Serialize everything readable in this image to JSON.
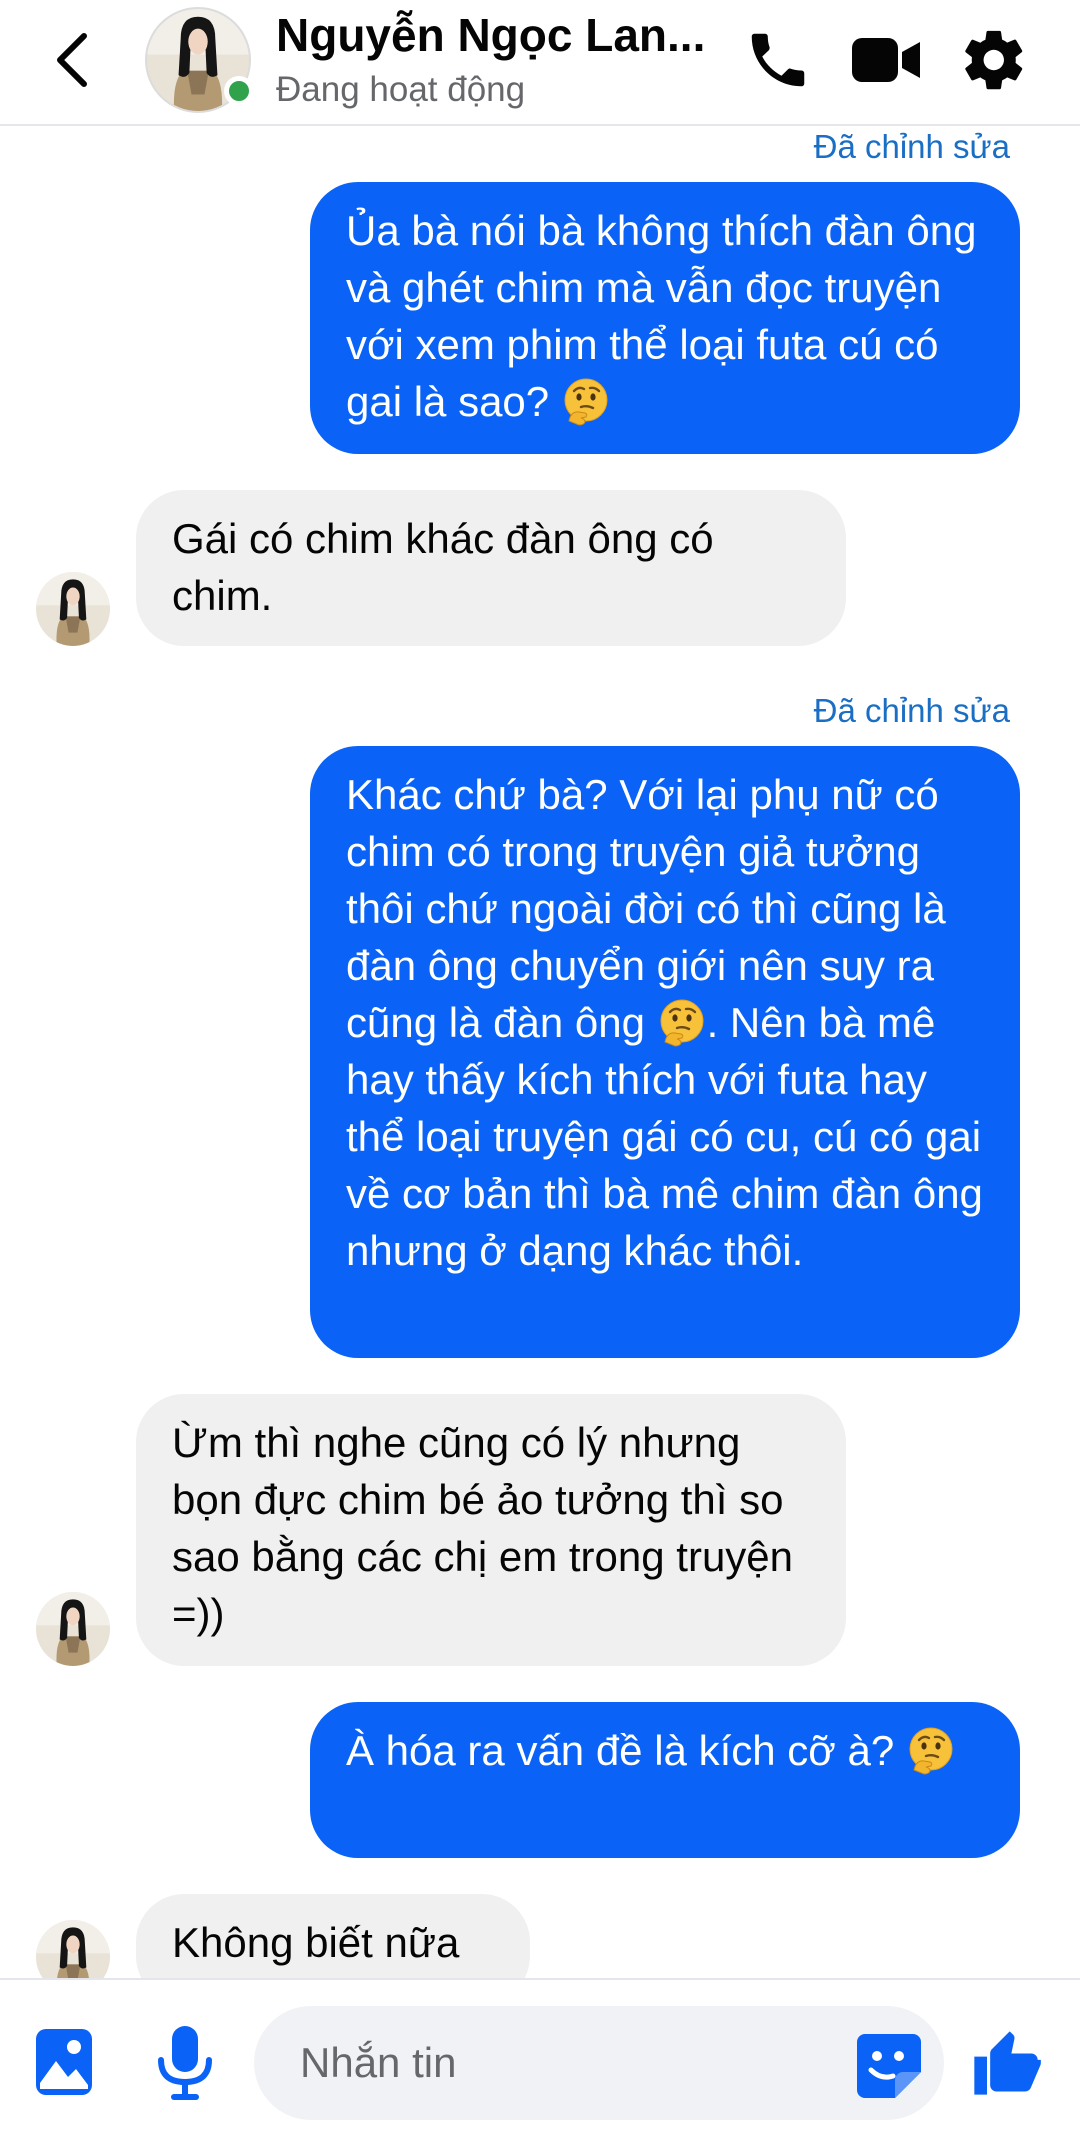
{
  "colors": {
    "accent": "#0a63f6",
    "incoming_bubble": "#f0f0f0",
    "online": "#31a24c",
    "edited_label": "#1a6fc4"
  },
  "header": {
    "back_icon": "chevron-left-icon",
    "contact_name": "Nguyễn Ngọc Lan...",
    "status": "Đang hoạt động",
    "actions": [
      "phone-icon",
      "video-camera-icon",
      "gear-icon"
    ]
  },
  "messages": [
    {
      "sender": "me",
      "edited_label": "Đã chỉnh sửa",
      "text": "Ủa bà nói bà không thích đàn ông và ghét chim mà vẫn đọc truyện với xem phim thể loại futa cú có gai là sao? ",
      "emoji": "thinking-face"
    },
    {
      "sender": "contact",
      "text": "Gái có chim khác đàn ông có chim."
    },
    {
      "sender": "me",
      "edited_label": "Đã chỉnh sửa",
      "text_before": "Khác chứ bà? Với lại phụ nữ có chim có trong truyện giả tưởng thôi chứ ngoài đời có thì cũng là đàn ông chuyển giới nên suy ra cũng là đàn ông ",
      "emoji": "thinking-face",
      "text_after": ". Nên bà mê hay thấy kích thích với futa hay thể loại truyện gái có cu, cú có gai về cơ bản thì bà mê chim đàn ông nhưng ở dạng khác thôi."
    },
    {
      "sender": "contact",
      "text": "Ừm thì nghe cũng có lý nhưng bọn đực chim bé ảo tưởng thì so sao bằng các chị em trong truyện =))"
    },
    {
      "sender": "me",
      "text": "À hóa ra vấn đề là kích cỡ à? ",
      "emoji": "thinking-face"
    },
    {
      "sender": "contact",
      "text": "Không biết nữa"
    }
  ],
  "composer": {
    "gallery_icon": "image-gallery-icon",
    "mic_icon": "microphone-icon",
    "placeholder": "Nhắn tin",
    "sticker_icon": "sticker-icon",
    "like_icon": "thumbs-up-icon"
  }
}
